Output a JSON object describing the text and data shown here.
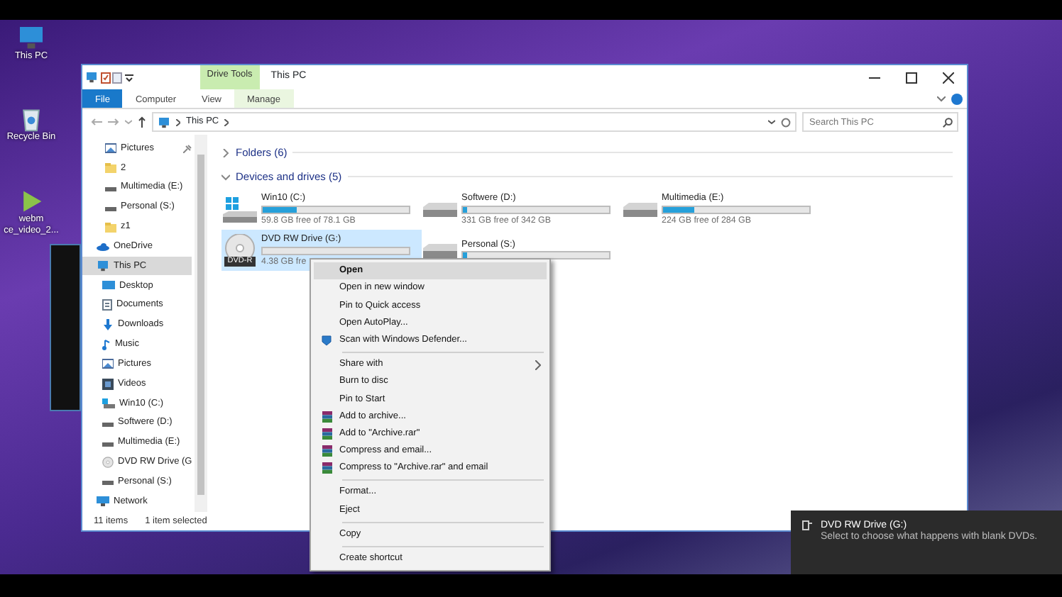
{
  "desktop_icons": [
    {
      "label": "This PC",
      "kind": "pc"
    },
    {
      "label": "Recycle Bin",
      "kind": "bin"
    },
    {
      "label": "webm\nce_video_2...",
      "kind": "video"
    }
  ],
  "window": {
    "title": "This PC",
    "context_tab_group": "Drive Tools",
    "ribbon_tabs": [
      {
        "label": "File",
        "kind": "file",
        "selected": false
      },
      {
        "label": "Computer",
        "kind": "tab",
        "selected": false
      },
      {
        "label": "View",
        "kind": "tab",
        "selected": false
      },
      {
        "label": "Manage",
        "kind": "context",
        "selected": false
      }
    ],
    "address": {
      "crumb": "This PC"
    },
    "search": {
      "placeholder": "Search This PC"
    },
    "nav": [
      {
        "label": "Pictures",
        "kind": "pictures",
        "pinned": true,
        "selected": false
      },
      {
        "label": "2",
        "kind": "folder",
        "pinned": false,
        "selected": false
      },
      {
        "label": "Multimedia (E:)",
        "kind": "drive",
        "pinned": false,
        "selected": false
      },
      {
        "label": "Personal (S:)",
        "kind": "drive",
        "pinned": false,
        "selected": false
      },
      {
        "label": "z1",
        "kind": "folder",
        "pinned": false,
        "selected": false
      },
      {
        "label": "OneDrive",
        "kind": "cloud",
        "pinned": false,
        "selected": false
      },
      {
        "label": "This PC",
        "kind": "pc",
        "pinned": false,
        "selected": true,
        "children": [
          {
            "label": "Desktop",
            "kind": "desktop",
            "pinned": false,
            "selected": false
          },
          {
            "label": "Documents",
            "kind": "documents",
            "pinned": false,
            "selected": false
          },
          {
            "label": "Downloads",
            "kind": "downloads",
            "pinned": false,
            "selected": false
          },
          {
            "label": "Music",
            "kind": "music",
            "pinned": false,
            "selected": false
          },
          {
            "label": "Pictures",
            "kind": "pictures",
            "pinned": false,
            "selected": false
          },
          {
            "label": "Videos",
            "kind": "videos",
            "pinned": false,
            "selected": false
          },
          {
            "label": "Win10 (C:)",
            "kind": "windrive",
            "pinned": false,
            "selected": false
          },
          {
            "label": "Softwere (D:)",
            "kind": "drive",
            "pinned": false,
            "selected": false
          },
          {
            "label": "Multimedia (E:)",
            "kind": "drive",
            "pinned": false,
            "selected": false
          },
          {
            "label": "DVD RW Drive (G",
            "kind": "disc",
            "pinned": false,
            "selected": false
          },
          {
            "label": "Personal (S:)",
            "kind": "drive",
            "pinned": false,
            "selected": false
          }
        ]
      },
      {
        "label": "Network",
        "kind": "network",
        "pinned": false,
        "selected": false
      }
    ],
    "groups": [
      {
        "title": "Folders (6)",
        "expanded": false
      },
      {
        "title": "Devices and drives (5)",
        "expanded": true
      }
    ],
    "drives": [
      {
        "name": "Win10 (C:)",
        "kind": "windows",
        "level": 0.23,
        "free": "59.8 GB free of 78.1 GB",
        "selected": false
      },
      {
        "name": "Softwere (D:)",
        "kind": "hdd",
        "level": 0.03,
        "free": "331 GB free of 342 GB",
        "selected": false
      },
      {
        "name": "Multimedia (E:)",
        "kind": "hdd",
        "level": 0.21,
        "free": "224 GB free of 284 GB",
        "selected": false
      },
      {
        "name": "DVD RW Drive (G:)",
        "kind": "dvd",
        "level": 0,
        "free": "4.38 GB fre",
        "media": "DVD-R",
        "selected": true
      },
      {
        "name": "Personal (S:)",
        "kind": "hdd",
        "level": 0.03,
        "selected": false
      }
    ],
    "status_bar": {
      "count": "11 items",
      "selection": "1 item selected"
    }
  },
  "context_menu": [
    {
      "kind": "default",
      "label": "Open",
      "selected": true
    },
    {
      "kind": "plain",
      "label": "Open in new window",
      "selected": false
    },
    {
      "kind": "plain",
      "label": "Pin to Quick access",
      "selected": false
    },
    {
      "kind": "plain",
      "label": "Open AutoPlay...",
      "selected": false
    },
    {
      "kind": "shield",
      "label": "Scan with Windows Defender...",
      "selected": false
    },
    {
      "kind": "separator"
    },
    {
      "kind": "submenu",
      "label": "Share with",
      "selected": false
    },
    {
      "kind": "plain",
      "label": "Burn to disc",
      "selected": false
    },
    {
      "kind": "plain",
      "label": "Pin to Start",
      "selected": false
    },
    {
      "kind": "archive",
      "label": "Add to archive...",
      "selected": false
    },
    {
      "kind": "archive",
      "label": "Add to \"Archive.rar\"",
      "selected": false
    },
    {
      "kind": "archive",
      "label": "Compress and email...",
      "selected": false
    },
    {
      "kind": "archive",
      "label": "Compress to \"Archive.rar\" and email",
      "selected": false
    },
    {
      "kind": "separator"
    },
    {
      "kind": "plain",
      "label": "Format...",
      "selected": false
    },
    {
      "kind": "plain",
      "label": "Eject",
      "selected": false
    },
    {
      "kind": "separator"
    },
    {
      "kind": "plain",
      "label": "Copy",
      "selected": false
    },
    {
      "kind": "separator"
    },
    {
      "kind": "plain",
      "label": "Create shortcut",
      "selected": false
    }
  ],
  "toast": {
    "title": "DVD RW Drive (G:)",
    "message": "Select to choose what happens with blank DVDs."
  }
}
